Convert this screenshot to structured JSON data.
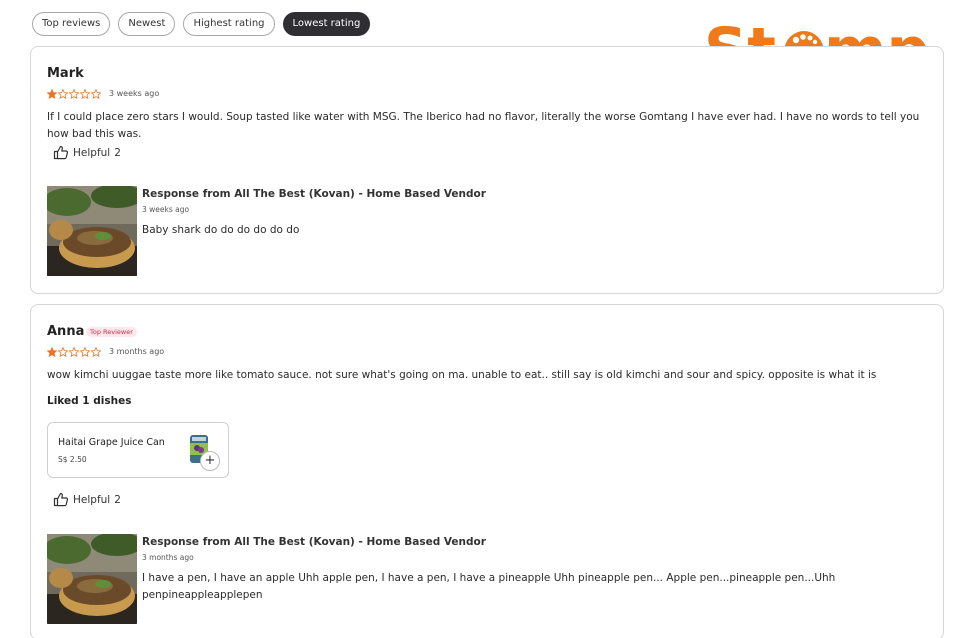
{
  "filters": [
    "Top reviews",
    "Newest",
    "Highest rating",
    "Lowest rating"
  ],
  "active_filter": "Lowest rating",
  "logo": {
    "text": "Stomp",
    "color": "#f07a1a"
  },
  "star_color": "#e8752a",
  "reviews": [
    {
      "name": "Mark",
      "rating": 1,
      "max_rating": 5,
      "time": "3 weeks ago",
      "text": "If I could place zero stars I would. Soup tasted like water with MSG. The Iberico had no flavor, literally the worse Gomtang I have ever had. I have no words to tell you how bad this was.",
      "helpful_label": "Helpful",
      "helpful_count": "2",
      "response": {
        "title": "Response from All The Best (Kovan) - Home Based Vendor",
        "time": "3 weeks ago",
        "text": "Baby shark do do do do do do"
      }
    },
    {
      "name": "Anna",
      "badge": "Top Reviewer",
      "rating": 1,
      "max_rating": 5,
      "time": "3 months ago",
      "text": "wow kimchi uuggae taste more like tomato sauce. not sure what's going on ma. unable to eat.. still say is old kimchi and sour and spicy. opposite is what it is",
      "liked_heading": "Liked 1 dishes",
      "liked_dishes": [
        {
          "name": "Haitai Grape Juice Can",
          "price": "S$ 2.50"
        }
      ],
      "helpful_label": "Helpful",
      "helpful_count": "2",
      "response": {
        "title": "Response from All The Best (Kovan) - Home Based Vendor",
        "time": "3 months ago",
        "text": "I have a pen, I have an apple Uhh apple pen, I have a pen, I have a pineapple Uhh pineapple pen... Apple pen...pineapple pen...Uhh penpineappleapplepen"
      }
    }
  ]
}
